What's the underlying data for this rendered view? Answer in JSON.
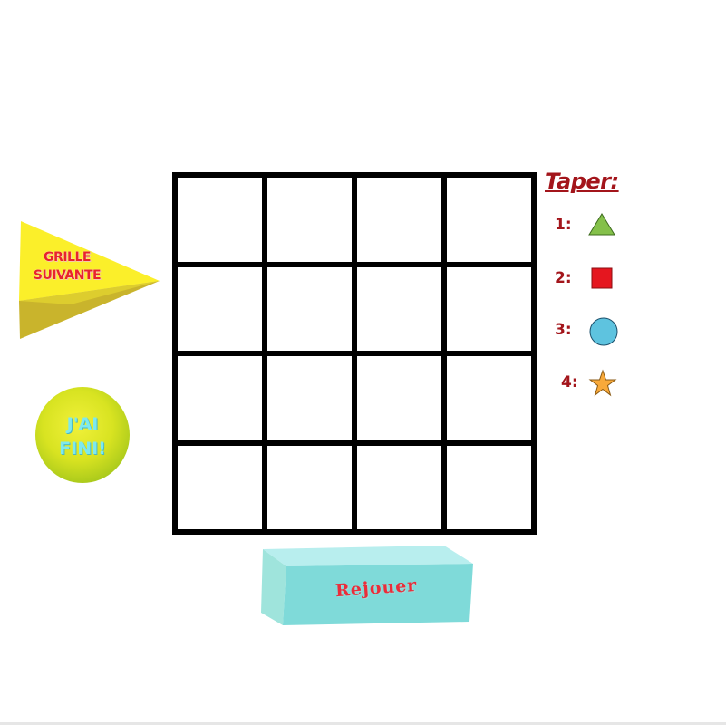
{
  "legend": {
    "title": "Taper:",
    "items": [
      {
        "key": "1:",
        "shape": "triangle-icon",
        "color": "#84c04a"
      },
      {
        "key": "2:",
        "shape": "square-icon",
        "color": "#e5161f"
      },
      {
        "key": "3:",
        "shape": "circle-icon",
        "color": "#5ec3df"
      },
      {
        "key": "4:",
        "shape": "star-icon",
        "color": "#f8a93a"
      }
    ]
  },
  "buttons": {
    "next_line1": "GRILLE",
    "next_line2": "SUIVANTE",
    "done_line1": "J'AI",
    "done_line2": "FINI!",
    "replay": "Rejouer"
  },
  "grid": {
    "rows": 4,
    "cols": 4,
    "cells": [
      "",
      "",
      "",
      "",
      "",
      "",
      "",
      "",
      "",
      "",
      "",
      "",
      "",
      "",
      "",
      ""
    ]
  },
  "colors": {
    "label_red": "#a3151b",
    "next_yellow": "#fbef2a",
    "replay_teal": "#7fdad9"
  }
}
